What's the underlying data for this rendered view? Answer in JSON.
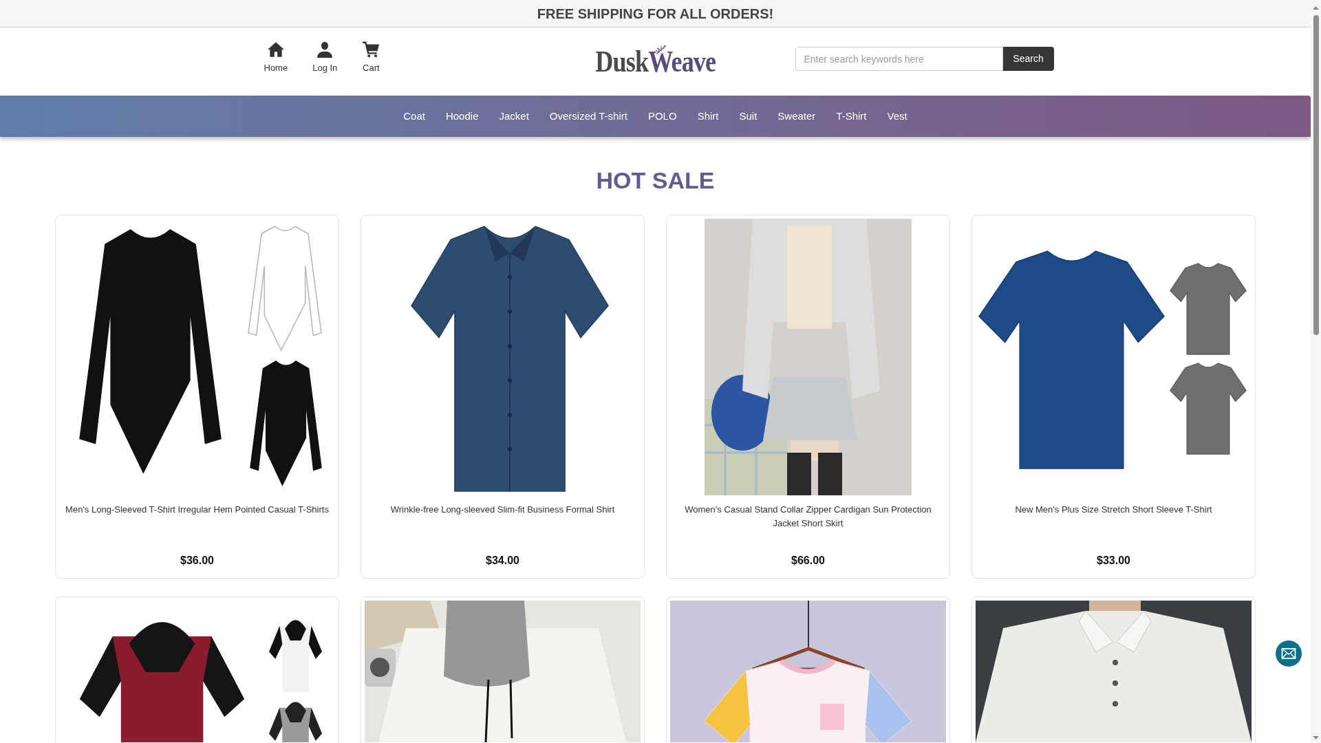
{
  "banner": {
    "text": "FREE SHIPPING FOR ALL ORDERS!"
  },
  "header": {
    "links": [
      {
        "label": "Home"
      },
      {
        "label": "Log In"
      },
      {
        "label": "Cart"
      }
    ],
    "logo": [
      "Dusk",
      "Weave"
    ],
    "search": {
      "placeholder": "Enter search keywords here",
      "button": "Search"
    }
  },
  "categories": [
    "Coat",
    "Hoodie",
    "Jacket",
    "Oversized T-shirt",
    "POLO",
    "Shirt",
    "Suit",
    "Sweater",
    "T-Shirt",
    "Vest"
  ],
  "section": {
    "title": "HOT SALE",
    "products": [
      {
        "kind": "listing",
        "title": "Men's Long-Sleeved T-Shirt Irregular Hem Pointed Casual T-Shirts",
        "price": "$36.00"
      },
      {
        "kind": "listing",
        "title": "Wrinkle-free Long-sleeved Slim-fit Business Formal Shirt",
        "price": "$34.00"
      },
      {
        "kind": "listing",
        "title": "Women's Casual Stand Collar Zipper Cardigan Sun Protection Jacket Short Skirt",
        "price": "$66.00"
      },
      {
        "kind": "listing",
        "title": "New Men's Plus Size Stretch Short Sleeve T-Shirt",
        "price": "$33.00"
      },
      {
        "kind": "partial"
      },
      {
        "kind": "partial"
      },
      {
        "kind": "partial"
      },
      {
        "kind": "partial"
      }
    ]
  }
}
